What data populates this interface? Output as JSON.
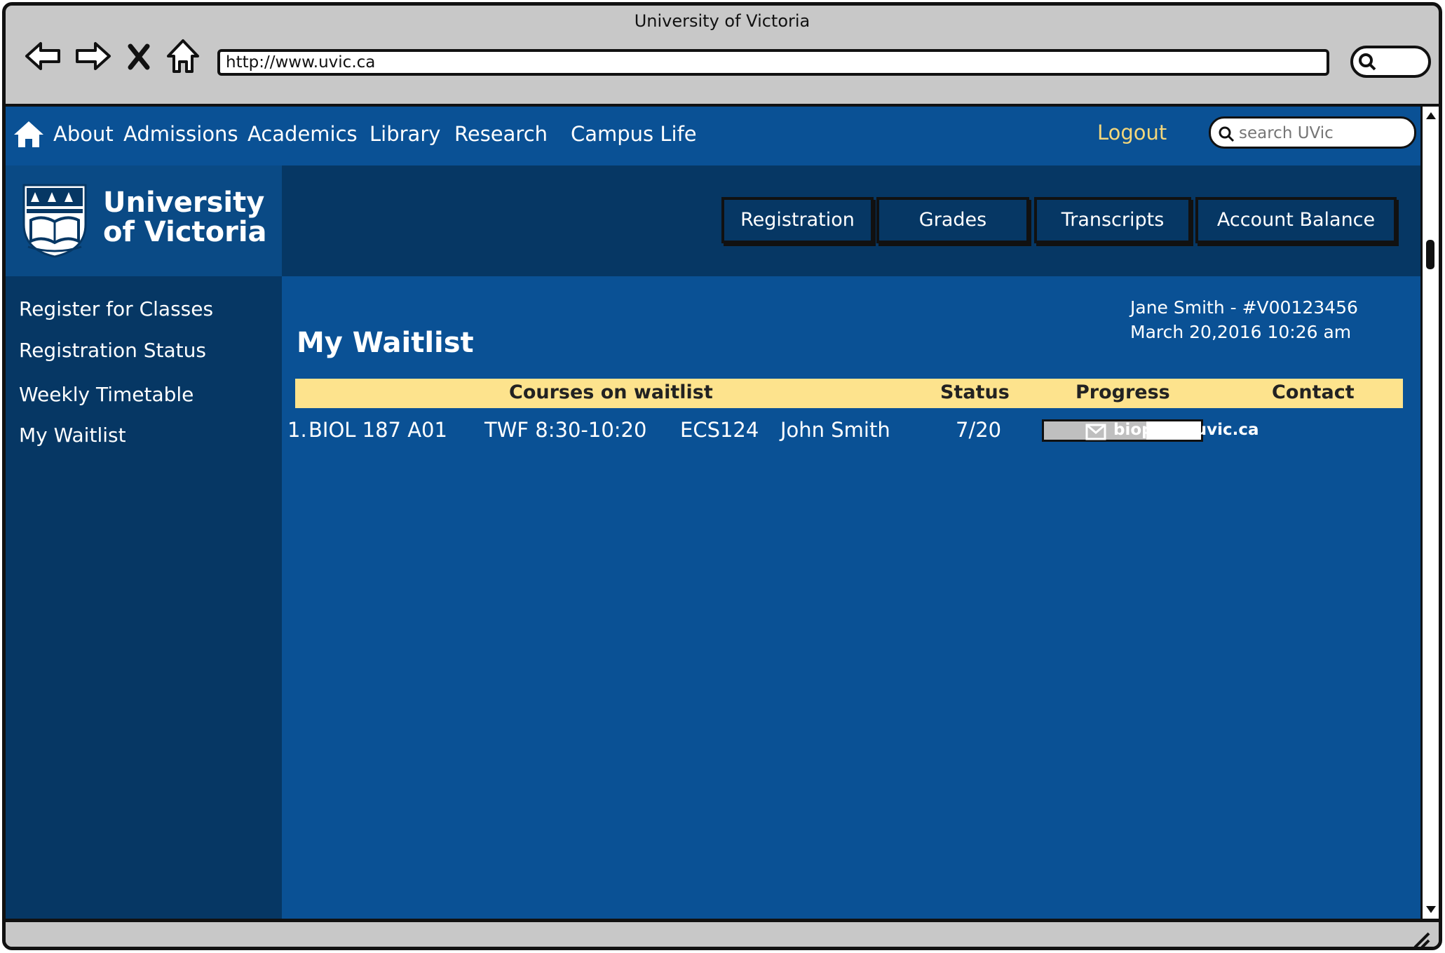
{
  "browser": {
    "title": "University of Victoria",
    "url": "http://www.uvic.ca"
  },
  "topnav": {
    "links": [
      "About",
      "Admissions",
      "Academics",
      "Library",
      "Research",
      "Campus Life"
    ],
    "logout": "Logout",
    "search_placeholder": "search UVic"
  },
  "logo": {
    "line1": "University",
    "line2": "of Victoria"
  },
  "tabs": [
    "Registration",
    "Grades",
    "Transcripts",
    "Account Balance"
  ],
  "sidebar": {
    "items": [
      "Register for Classes",
      "Registration Status",
      "Weekly Timetable",
      "My Waitlist"
    ]
  },
  "user": {
    "name_id": "Jane Smith - #V00123456",
    "datetime": "March 20,2016 10:26 am"
  },
  "page_title": "My Waitlist",
  "table": {
    "headers": [
      "Courses on waitlist",
      "Status",
      "Progress",
      "Contact"
    ],
    "rows": [
      {
        "number": "1.",
        "course": "BIOL 187 A01",
        "schedule": "TWF 8:30-10:20",
        "location": "ECS124",
        "instructor": "John Smith",
        "status": "7/20",
        "progress": 0.65,
        "contact": "bioprof@uvic.ca"
      }
    ]
  },
  "colors": {
    "primary": "#0a5195",
    "dark": "#063764",
    "header_highlight": "#fde38d",
    "logout": "#f4d77b"
  },
  "icons": [
    "back-arrow-icon",
    "forward-arrow-icon",
    "stop-icon",
    "home-icon",
    "search-icon",
    "mail-icon"
  ]
}
